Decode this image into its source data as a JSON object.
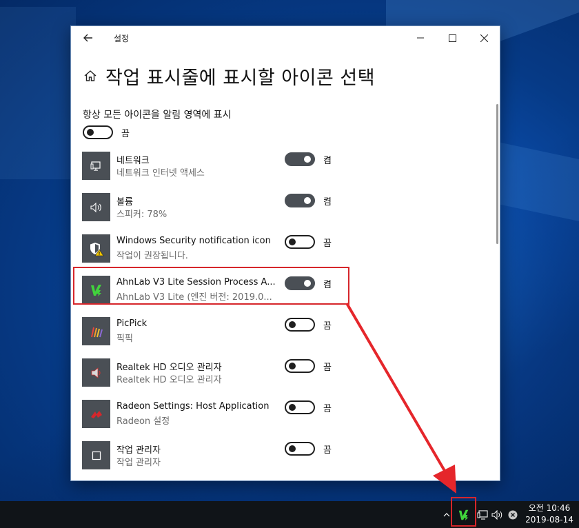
{
  "window": {
    "title": "설정",
    "page_title": "작업 표시줄에 표시할 아이콘 선택",
    "master_label": "항상 모든 아이콘을 알림 영역에 표시",
    "master_state": "끔"
  },
  "items": [
    {
      "name": "네트워크",
      "sub": "네트워크 인터넷 액세스",
      "state": "켬",
      "on": true,
      "icon": "network-icon"
    },
    {
      "name": "볼륨",
      "sub": "스피커: 78%",
      "state": "켬",
      "on": true,
      "icon": "volume-icon"
    },
    {
      "name": "Windows Security notification icon",
      "sub": "작업이 권장됩니다.",
      "state": "끔",
      "on": false,
      "icon": "shield-warning-icon"
    },
    {
      "name": "AhnLab V3 Lite Session Process A...",
      "sub": "AhnLab V3 Lite (엔진 버전: 2019.0...",
      "state": "켬",
      "on": true,
      "icon": "ahnlab-v3-icon"
    },
    {
      "name": "PicPick",
      "sub": "픽픽",
      "state": "끔",
      "on": false,
      "icon": "picpick-icon"
    },
    {
      "name": "Realtek HD 오디오 관리자",
      "sub": "Realtek HD 오디오 관리자",
      "state": "끔",
      "on": false,
      "icon": "realtek-speaker-icon"
    },
    {
      "name": "Radeon Settings: Host Application",
      "sub": "Radeon 설정",
      "state": "끔",
      "on": false,
      "icon": "radeon-icon"
    },
    {
      "name": "작업 관리자",
      "sub": "작업 관리자",
      "state": "끔",
      "on": false,
      "icon": "task-manager-icon"
    }
  ],
  "taskbar": {
    "time": "오전 10:46",
    "date": "2019-08-14"
  },
  "colors": {
    "highlight": "#d6262b",
    "toggle_on": "#4a4f55",
    "tile": "#4a4f55",
    "ahnlab_green": "#41d43c"
  }
}
